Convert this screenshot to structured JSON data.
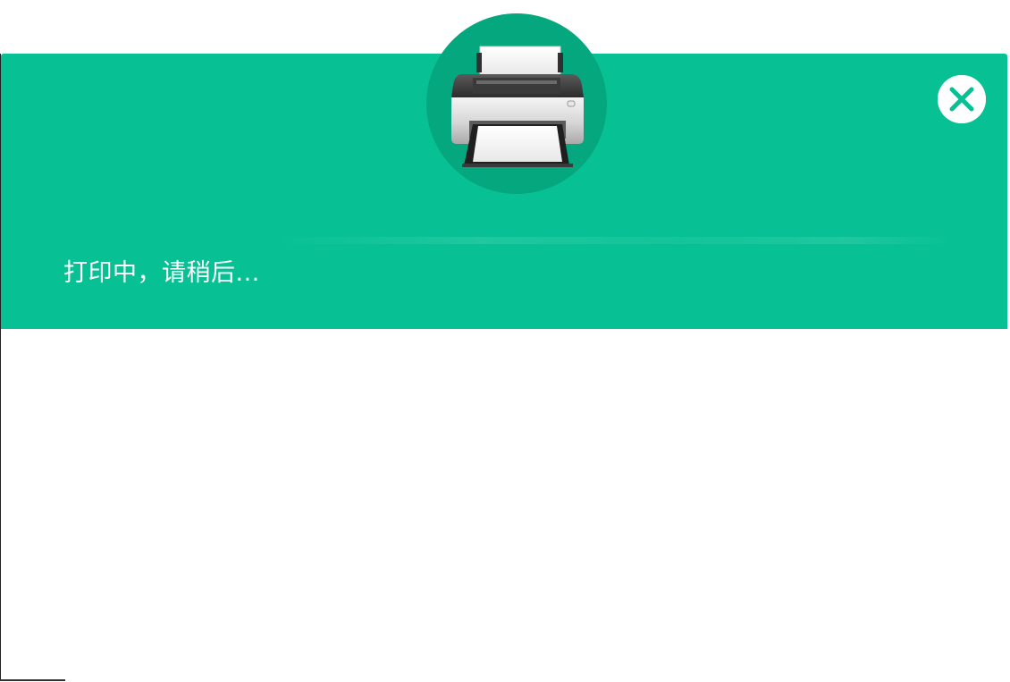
{
  "dialog": {
    "status_text": "打印中，请稍后...",
    "icons": {
      "printer": "printer-icon",
      "close": "close-icon"
    }
  },
  "colors": {
    "banner": "#07c194",
    "badge": "#05a77f",
    "close_mark": "#07c194",
    "background": "#ffffff"
  }
}
